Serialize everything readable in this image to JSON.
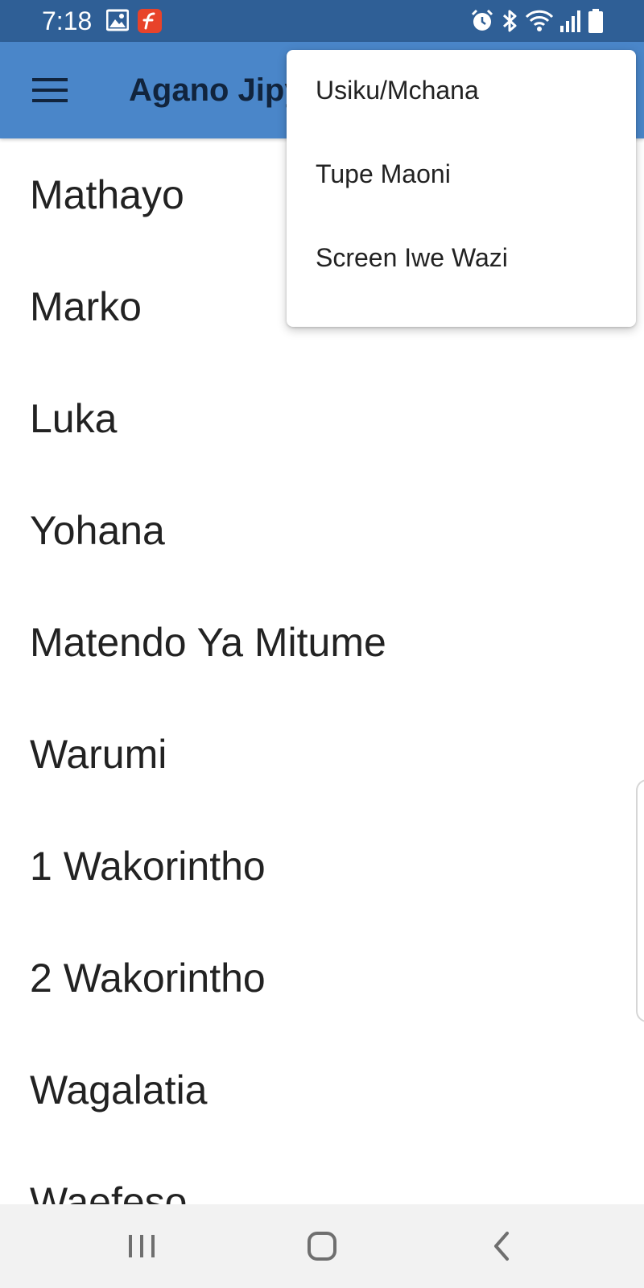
{
  "status_bar": {
    "time": "7:18",
    "background": "#2f5f96",
    "left_icons": [
      "gallery-icon",
      "flash-app-icon"
    ],
    "right_icons": [
      "alarm-icon",
      "bluetooth-icon",
      "wifi-icon",
      "signal-icon",
      "battery-icon"
    ]
  },
  "app_bar": {
    "title": "Agano Jipya",
    "background": "#4a86c9",
    "menu_icon": "hamburger-menu-icon"
  },
  "book_list": {
    "items": [
      "Mathayo",
      "Marko",
      "Luka",
      "Yohana",
      "Matendo Ya Mitume",
      "Warumi",
      "1 Wakorintho",
      "2 Wakorintho",
      "Wagalatia",
      "Waefeso"
    ]
  },
  "overflow_menu": {
    "items": [
      "Usiku/Mchana",
      "Tupe Maoni",
      "Screen Iwe Wazi"
    ]
  },
  "nav_bar": {
    "buttons": [
      "recent-apps-icon",
      "home-icon",
      "back-icon"
    ]
  }
}
